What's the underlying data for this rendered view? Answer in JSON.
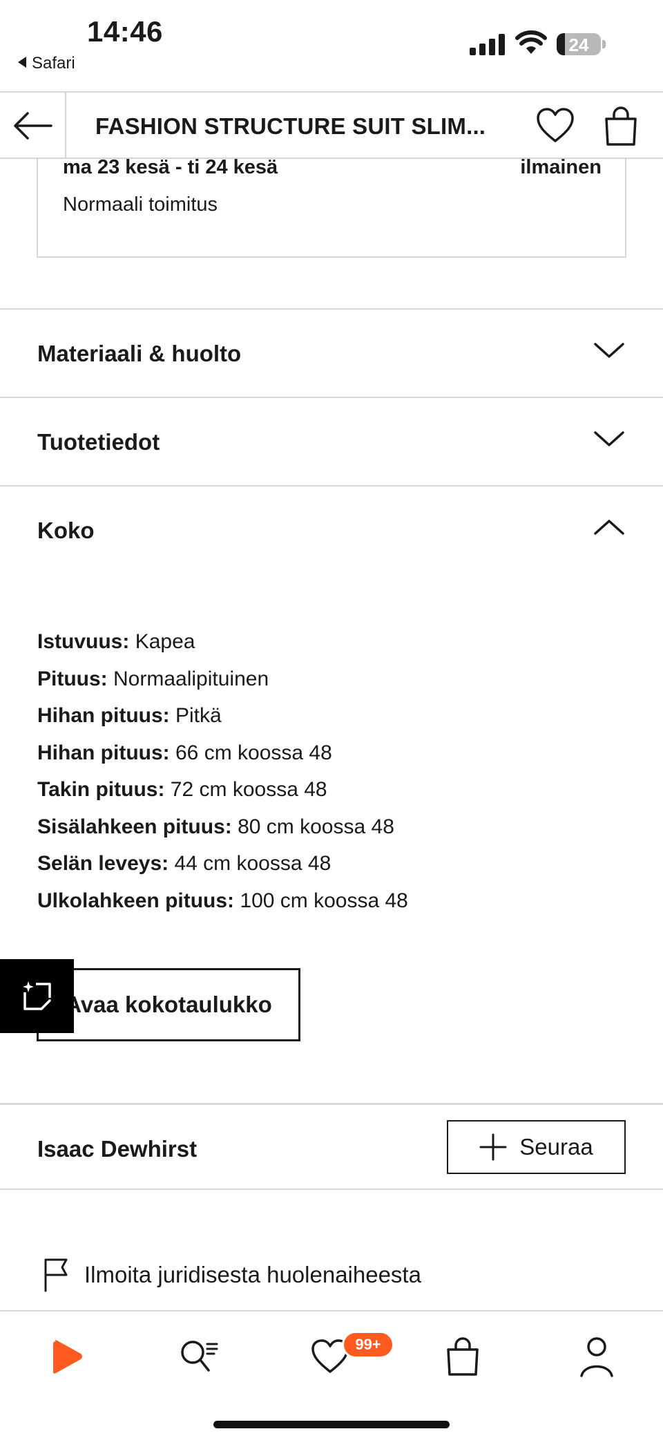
{
  "status_bar": {
    "time": "14:46",
    "back_app": "Safari",
    "battery": "24"
  },
  "header": {
    "title": "FASHION STRUCTURE SUIT SLIM...",
    "back_icon": "arrow-left-icon",
    "favorite_icon": "heart-icon",
    "bag_icon": "shopping-bag-icon"
  },
  "delivery": {
    "date_range": "ma 23 kesä - ti 24 kesä",
    "price": "ilmainen",
    "type": "Normaali toimitus"
  },
  "accordion": {
    "material": "Materiaali & huolto",
    "product_info": "Tuotetiedot",
    "size": "Koko"
  },
  "size_details": [
    {
      "label": "Istuvuus:",
      "value": "Kapea"
    },
    {
      "label": "Pituus:",
      "value": "Normaalipituinen"
    },
    {
      "label": "Hihan pituus:",
      "value": "Pitkä"
    },
    {
      "label": "Hihan pituus:",
      "value": "66 cm koossa 48"
    },
    {
      "label": "Takin pituus:",
      "value": "72 cm koossa 48"
    },
    {
      "label": "Sisälahkeen pituus:",
      "value": "80 cm koossa 48"
    },
    {
      "label": "Selän leveys:",
      "value": "44 cm koossa 48"
    },
    {
      "label": "Ulkolahkeen pituus:",
      "value": "100 cm koossa 48"
    }
  ],
  "size_chart_button": "Avaa kokotaulukko",
  "brand": {
    "name": "Isaac Dewhirst",
    "follow_label": "Seuraa"
  },
  "report": {
    "label": "Ilmoita juridisesta huolenaiheesta"
  },
  "bottom_nav": {
    "items": [
      "home-icon",
      "search-icon",
      "wishlist-icon",
      "bag-icon",
      "profile-icon"
    ],
    "wishlist_badge": "99+"
  },
  "colors": {
    "accent": "#ff5a1f",
    "text": "#1a1a1a",
    "divider": "#d6d6d6"
  }
}
